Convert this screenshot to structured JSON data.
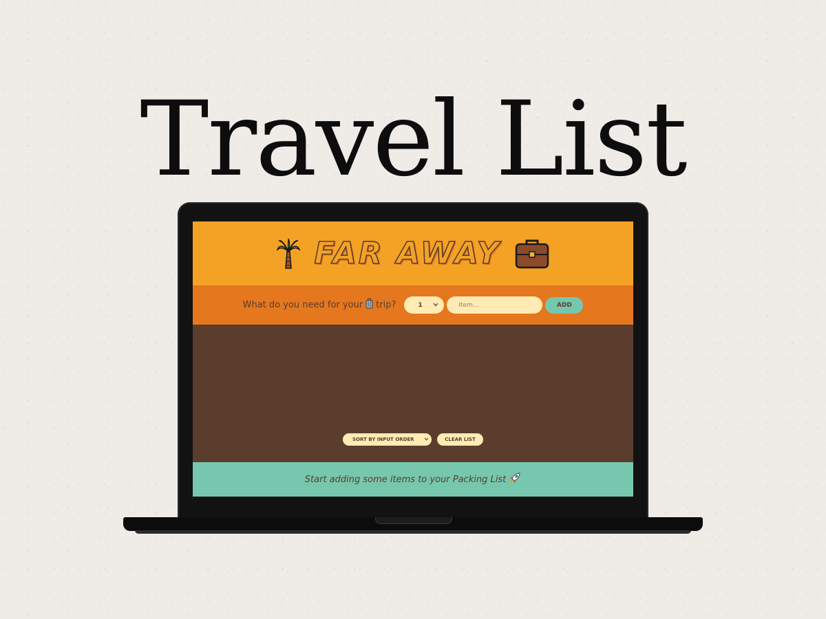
{
  "hero": {
    "title": "Travel List"
  },
  "app": {
    "logo_text": "FAR AWAY",
    "form": {
      "question": "What do you need for your",
      "question_suffix": "trip?",
      "quantity_value": "1",
      "item_placeholder": "Item...",
      "add_label": "ADD"
    },
    "actions": {
      "sort_selected": "SORT BY INPUT ORDER",
      "clear_label": "CLEAR LIST"
    },
    "footer": {
      "message": "Start adding some items to your Packing List"
    }
  },
  "icons": {
    "header_left": "palm-tree-icon",
    "header_right": "briefcase-icon",
    "form": "luggage-icon",
    "footer": "rocket-icon"
  },
  "colors": {
    "header_bg": "#f4a226",
    "form_bg": "#e5771f",
    "list_bg": "#5a3d2d",
    "footer_bg": "#76c7ad",
    "field_bg": "#ffebb3",
    "page_bg": "#efebe6"
  }
}
